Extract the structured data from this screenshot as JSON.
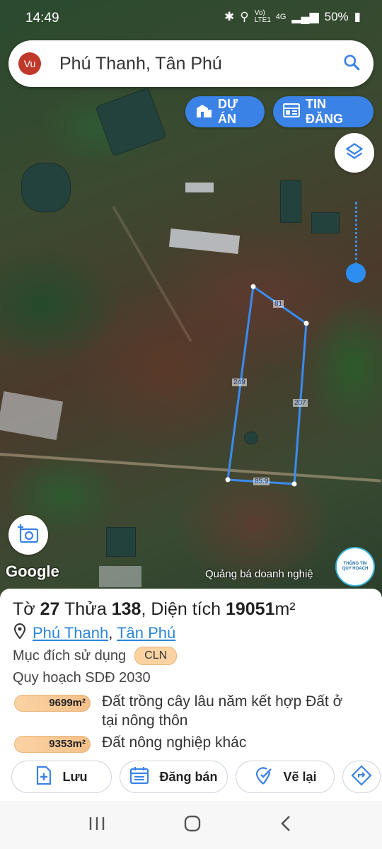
{
  "status": {
    "time": "14:49",
    "battery": "50%",
    "network": "4G",
    "volte": "Vo) LTE1"
  },
  "search": {
    "avatar": "Vu",
    "place": "Phú Thanh, Tân Phú"
  },
  "buttons": {
    "du_an": "DỰ ÁN",
    "tin_dang": "TIN ĐĂNG"
  },
  "map": {
    "google": "Google",
    "promo": "Quảng bá doanh nghiệ",
    "info_badge": [
      "THÔNG TIN",
      "QUY HOẠCH"
    ],
    "edges": {
      "top": "81",
      "left": "249",
      "right": "207",
      "bottom": "85.9"
    }
  },
  "parcel": {
    "to_label": "Tờ",
    "to_value": "27",
    "thua_label": "Thửa",
    "thua_value": "138",
    "area_label": ", Diện tích",
    "area_value": "19051",
    "area_unit": "m²",
    "ward": "Phú Thanh",
    "district": "Tân Phú",
    "purpose_label": "Mục đích sử dụng",
    "purpose_code": "CLN",
    "plan_label": "Quy hoạch SDĐ 2030",
    "plans": [
      {
        "area": "9699m²",
        "desc": "Đất trồng cây lâu năm kết hợp Đất ở tại nông thôn"
      },
      {
        "area": "9353m²",
        "desc": "Đất nông nghiệp khác"
      }
    ]
  },
  "actions": {
    "save": "Lưu",
    "sell": "Đăng bán",
    "redraw": "Vẽ lại"
  },
  "colors": {
    "accent": "#3b82e6",
    "parcel_line": "#3a8cf0",
    "badge": "#fbd3a3"
  }
}
